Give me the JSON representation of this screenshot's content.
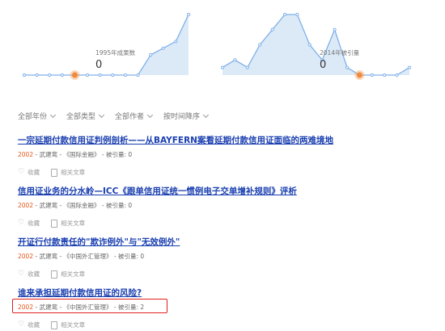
{
  "charts": [
    {
      "tooltip_label": "1995年成果数",
      "tooltip_value": "0",
      "series": [
        0,
        0,
        0,
        0,
        0,
        0,
        0,
        0,
        0,
        0,
        3,
        4,
        5,
        9
      ],
      "highlight_index": 4,
      "ylim": [
        0,
        9
      ]
    },
    {
      "tooltip_label": "2014年被引量",
      "tooltip_value": "0",
      "series": [
        1,
        2,
        1,
        4,
        6,
        8,
        8,
        4,
        2,
        6,
        1,
        0,
        0,
        0,
        0,
        1
      ],
      "highlight_index": 11,
      "ylim": [
        0,
        8
      ]
    }
  ],
  "filters": [
    "全部年份",
    "全部类型",
    "全部作者",
    "按时间降序"
  ],
  "results": [
    {
      "title": "一宗延期付款信用证判例剖析——从BAYFERN案看延期付款信用证面临的两难境地",
      "year": "2002",
      "meta": " - 武建鸾 - 《国际金融》 - 被引量: 0"
    },
    {
      "title": "信用证业务的分水岭—ICC《跟单信用证统一惯例电子交单增补规则》评析",
      "year": "2002",
      "meta": " - 武建鸾 - 《国际金融》 - 被引量: 0"
    },
    {
      "title": "开证行付款责任的\"欺诈例外\"与\"无效例外\"",
      "year": "2002",
      "meta": " - 武建鸾 - 《中国外汇管理》 - 被引量: 0"
    },
    {
      "title": "谁来承担延期付款信用证的风险?",
      "year": "2002",
      "meta": " - 武建鸾 - 《中国外汇管理》 - 被引量: 2"
    }
  ],
  "actions": {
    "favorite": "收藏",
    "related": "相关文章"
  },
  "colors": {
    "accent": "#1a3fb0",
    "year": "#e2561a",
    "line": "#7fb0e8",
    "area": "#dceaf8",
    "dot": "#f5a96b",
    "highlight": "#e02020"
  }
}
